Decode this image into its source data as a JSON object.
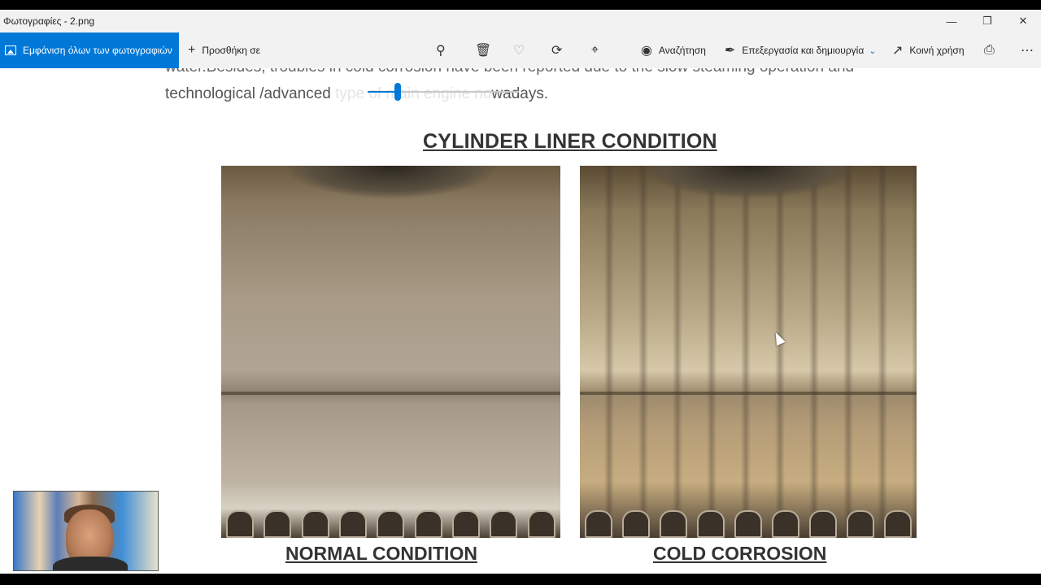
{
  "window": {
    "title": "Φωτογραφίες - 2.png",
    "minimize_icon": "minimize-icon",
    "restore_icon": "restore-icon",
    "close_icon": "close-icon"
  },
  "toolbar": {
    "all_photos_label": "Εμφάνιση όλων των φωτογραφιών",
    "add_to_label": "Προσθήκη σε",
    "search_label": "Αναζήτηση",
    "edit_create_label": "Επεξεργασία και δημιουργία",
    "share_label": "Κοινή χρήση",
    "accent_color": "#0078d7"
  },
  "zoom": {
    "level_fraction": 0.2
  },
  "document": {
    "line1": "water.Besides, troubles in cold corrosion have been reported due to the slow steaming operation and",
    "line2_start": "technological /advanced",
    "line2_hidden": " type of main engine no",
    "line2_end": "wadays.",
    "heading": "CYLINDER LINER CONDITION",
    "caption_left": "NORMAL CONDITION",
    "caption_right": "COLD CORROSION"
  }
}
